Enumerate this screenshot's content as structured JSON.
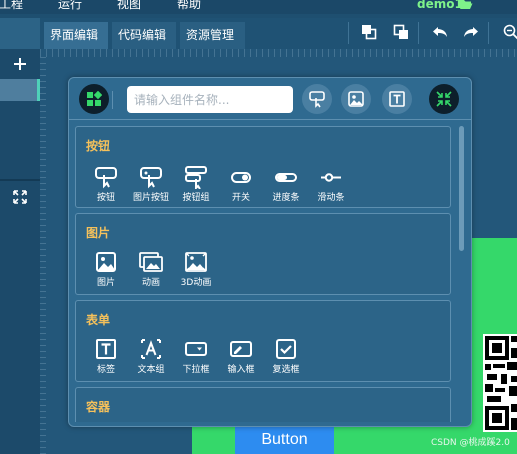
{
  "menubar": {
    "items": [
      {
        "label": "工程"
      },
      {
        "label": "运行"
      },
      {
        "label": "视图"
      },
      {
        "label": "帮助"
      }
    ],
    "project_name": "demo1"
  },
  "tabs": [
    {
      "label": "界面编辑",
      "active": true
    },
    {
      "label": "代码编辑",
      "active": false
    },
    {
      "label": "资源管理",
      "active": false
    }
  ],
  "toolbar_icons": [
    "bring-front-icon",
    "send-back-icon",
    "undo-icon",
    "redo-icon",
    "zoom-icon"
  ],
  "palette": {
    "search_placeholder": "请输入组件名称...",
    "sections": [
      {
        "title": "按钮",
        "items": [
          {
            "label": "按钮",
            "icon": "button-icon"
          },
          {
            "label": "图片按钮",
            "icon": "image-button-icon"
          },
          {
            "label": "按钮组",
            "icon": "button-group-icon"
          },
          {
            "label": "开关",
            "icon": "switch-icon"
          },
          {
            "label": "进度条",
            "icon": "progress-bar-icon"
          },
          {
            "label": "滑动条",
            "icon": "slider-icon"
          }
        ]
      },
      {
        "title": "图片",
        "items": [
          {
            "label": "图片",
            "icon": "image-icon"
          },
          {
            "label": "动画",
            "icon": "animation-icon"
          },
          {
            "label": "3D动画",
            "icon": "3d-animation-icon"
          }
        ]
      },
      {
        "title": "表单",
        "items": [
          {
            "label": "标签",
            "icon": "label-icon"
          },
          {
            "label": "文本组",
            "icon": "text-group-icon"
          },
          {
            "label": "下拉框",
            "icon": "dropdown-icon"
          },
          {
            "label": "输入框",
            "icon": "input-icon"
          },
          {
            "label": "复选框",
            "icon": "checkbox-icon"
          }
        ]
      },
      {
        "title": "容器",
        "items": []
      }
    ]
  },
  "canvas": {
    "button_label": "Button"
  },
  "watermark": "CSDN @桃成蹊2.0",
  "colors": {
    "background": "#1e4f70",
    "section_title": "#f5c15b",
    "project_name": "#7ef28a",
    "canvas_green": "#35d86a",
    "button_blue": "#2d8cf0"
  }
}
